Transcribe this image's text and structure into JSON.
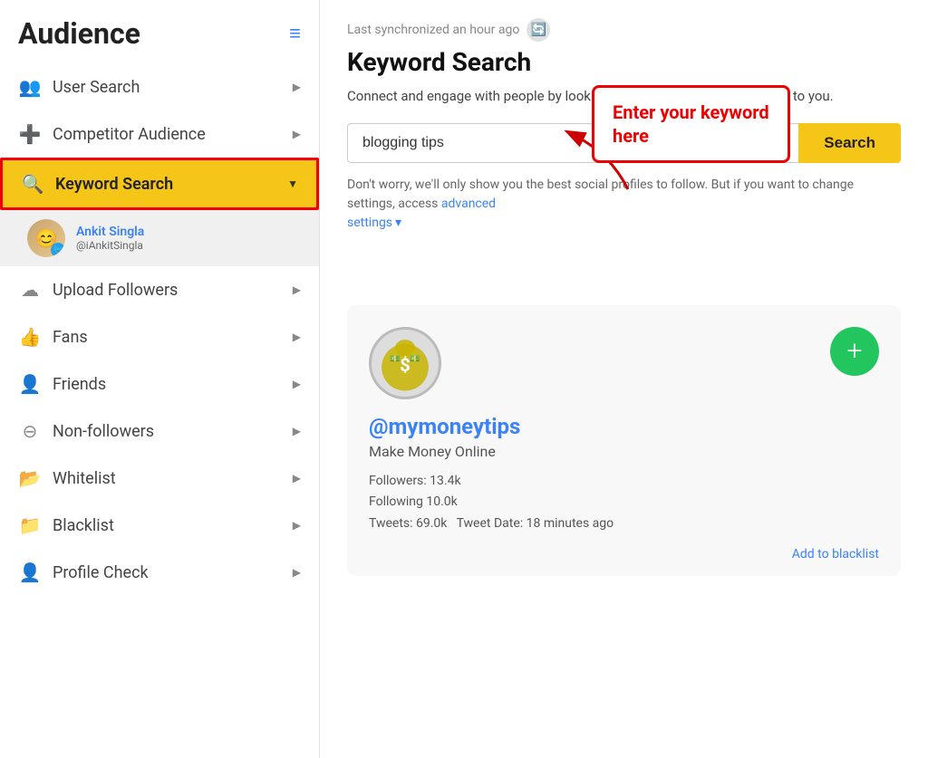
{
  "sidebar": {
    "title": "Audience",
    "hamburger": "≡",
    "items": [
      {
        "id": "user-search",
        "label": "User Search",
        "icon": "👥",
        "arrow": "▶",
        "active": false
      },
      {
        "id": "competitor-audience",
        "label": "Competitor Audience",
        "icon": "➕",
        "arrow": "▶",
        "active": false
      },
      {
        "id": "keyword-search",
        "label": "Keyword Search",
        "icon": "🔍",
        "arrow": "▼",
        "active": true
      },
      {
        "id": "upload-followers",
        "label": "Upload Followers",
        "icon": "☁",
        "arrow": "▶",
        "active": false
      },
      {
        "id": "fans",
        "label": "Fans",
        "icon": "👍",
        "arrow": "▶",
        "active": false
      },
      {
        "id": "friends",
        "label": "Friends",
        "icon": "👤",
        "arrow": "▶",
        "active": false
      },
      {
        "id": "non-followers",
        "label": "Non-followers",
        "icon": "⊖",
        "arrow": "▶",
        "active": false
      },
      {
        "id": "whitelist",
        "label": "Whitelist",
        "icon": "📂",
        "arrow": "▶",
        "active": false
      },
      {
        "id": "blacklist",
        "label": "Blacklist",
        "icon": "📁",
        "arrow": "▶",
        "active": false
      },
      {
        "id": "profile-check",
        "label": "Profile Check",
        "icon": "👤",
        "arrow": "▶",
        "active": false
      }
    ],
    "account": {
      "name": "Ankit Singla",
      "handle": "@iAnkitSingla"
    }
  },
  "main": {
    "sync_text": "Last synchronized an hour ago",
    "page_title": "Keyword Search",
    "page_desc": "Connect and engage with people by looking up keywords that are relevant to you.",
    "search_placeholder": "blogging tips",
    "search_value": "blogging tips",
    "search_button_label": "Search",
    "note_text": "Don't worry, we'll only show you the best social profiles to follow. But if you want to change settings, access",
    "advanced_label": "advanced",
    "settings_label": "settings",
    "callout_text": "Enter your keyword\nhere",
    "profile_card": {
      "username": "@mymoneytips",
      "bio": "Make Money Online",
      "followers": "Followers: 13.4k",
      "following": "Following 10.0k",
      "tweets": "Tweets: 69.0k",
      "tweet_date": "Tweet Date: 18 minutes ago",
      "add_button": "+",
      "blacklist_label": "Add to blacklist"
    }
  }
}
